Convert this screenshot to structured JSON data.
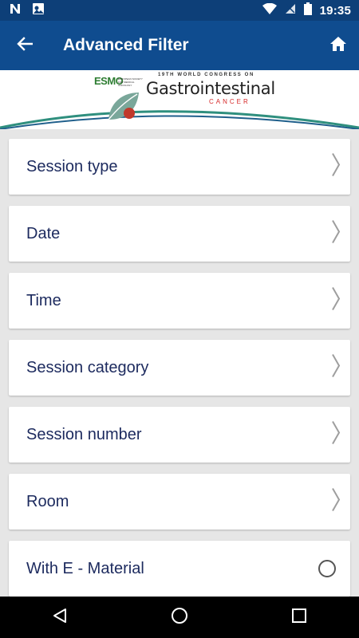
{
  "status_bar": {
    "time": "19:35",
    "icons": [
      "n-notification-icon",
      "image-location-icon",
      "wifi-icon",
      "no-sim-icon",
      "battery-icon"
    ]
  },
  "app_bar": {
    "title": "Advanced Filter",
    "back_icon": "arrow-back-icon",
    "home_icon": "home-icon",
    "background": "#0f4c8f"
  },
  "banner": {
    "esmo": "ESMO",
    "esmo_sub": "EUROPEAN SOCIETY FOR MEDICAL ONCOLOGY",
    "congress": "19TH WORLD CONGRESS ON",
    "title": "Gastrointestinal",
    "subtitle": "CANCER"
  },
  "filters": [
    {
      "label": "Session type",
      "control": "chevron"
    },
    {
      "label": "Date",
      "control": "chevron"
    },
    {
      "label": "Time",
      "control": "chevron"
    },
    {
      "label": "Session category",
      "control": "chevron"
    },
    {
      "label": "Session number",
      "control": "chevron"
    },
    {
      "label": "Room",
      "control": "chevron"
    },
    {
      "label": "With E - Material",
      "control": "radio",
      "selected": false
    }
  ],
  "nav_bar": {
    "icons": [
      "back-triangle-icon",
      "home-circle-icon",
      "recents-square-icon"
    ]
  },
  "colors": {
    "status_bar": "#0d3f78",
    "app_bar": "#0f4c8f",
    "label_text": "#1c2a5e",
    "list_background": "#e6e6e6"
  }
}
